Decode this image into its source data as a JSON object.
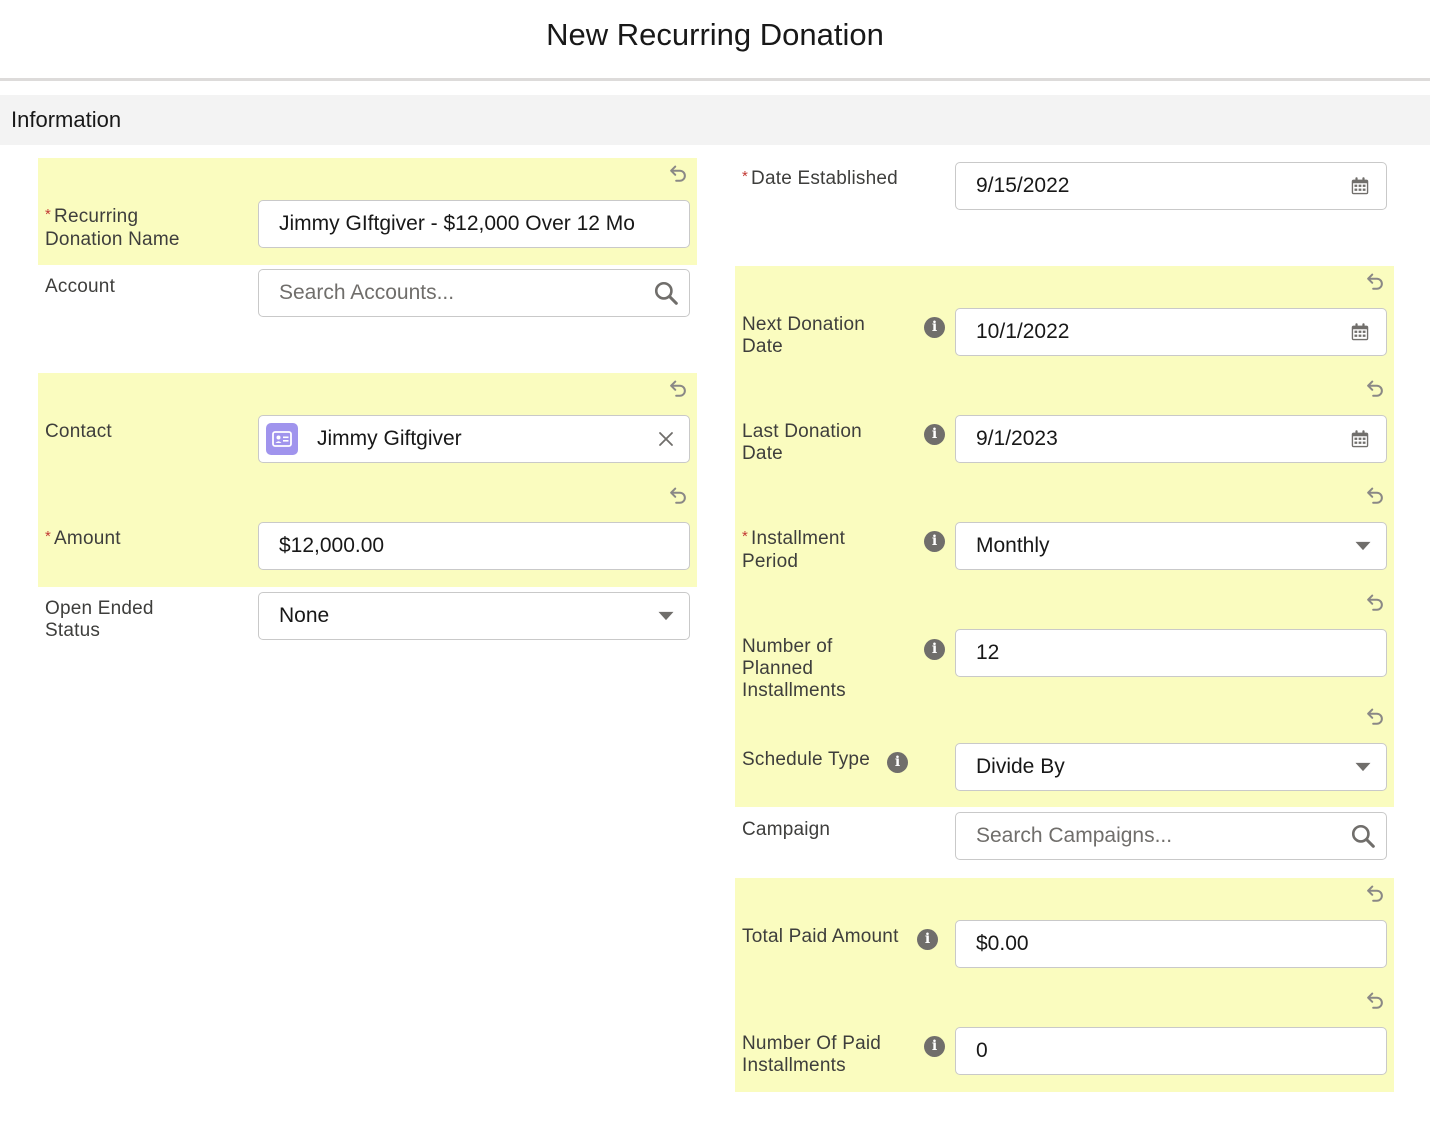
{
  "page": {
    "title": "New Recurring Donation"
  },
  "section": {
    "title": "Information"
  },
  "left": {
    "recurring_donation_name": {
      "label_line1": "Recurring",
      "label_line2": "Donation Name",
      "required": "*",
      "value": "Jimmy GIftgiver - $12,000 Over 12 Mo"
    },
    "account": {
      "label": "Account",
      "placeholder": "Search Accounts..."
    },
    "contact": {
      "label": "Contact",
      "value": "Jimmy Giftgiver"
    },
    "amount": {
      "label": "Amount",
      "required": "*",
      "value": "$12,000.00"
    },
    "open_ended_status": {
      "label_line1": "Open Ended",
      "label_line2": "Status",
      "value": "None"
    }
  },
  "right": {
    "date_established": {
      "label": "Date Established",
      "required": "*",
      "value": "9/15/2022"
    },
    "next_donation_date": {
      "label_line1": "Next Donation",
      "label_line2": "Date",
      "value": "10/1/2022"
    },
    "last_donation_date": {
      "label_line1": "Last Donation",
      "label_line2": "Date",
      "value": "9/1/2023"
    },
    "installment_period": {
      "label_line1": "Installment",
      "label_line2": "Period",
      "required": "*",
      "value": "Monthly"
    },
    "number_of_planned_installments": {
      "label_line1": "Number of",
      "label_line2": "Planned",
      "label_line3": "Installments",
      "value": "12"
    },
    "schedule_type": {
      "label": "Schedule Type",
      "value": "Divide By"
    },
    "campaign": {
      "label": "Campaign",
      "placeholder": "Search Campaigns..."
    },
    "total_paid_amount": {
      "label": "Total Paid Amount",
      "value": "$0.00"
    },
    "number_of_paid_installments": {
      "label_line1": "Number Of Paid",
      "label_line2": "Installments",
      "value": "0"
    }
  },
  "icons": {
    "undo": "undo-icon",
    "info": "info-icon",
    "calendar": "calendar-icon",
    "search": "search-icon",
    "dropdown": "chevron-down-icon",
    "clear": "close-icon",
    "contact": "contact-card-icon"
  },
  "colors": {
    "highlight": "#fafcbf",
    "required": "#c23934",
    "contact_badge": "#a094ed",
    "border": "#c9c9c9"
  }
}
